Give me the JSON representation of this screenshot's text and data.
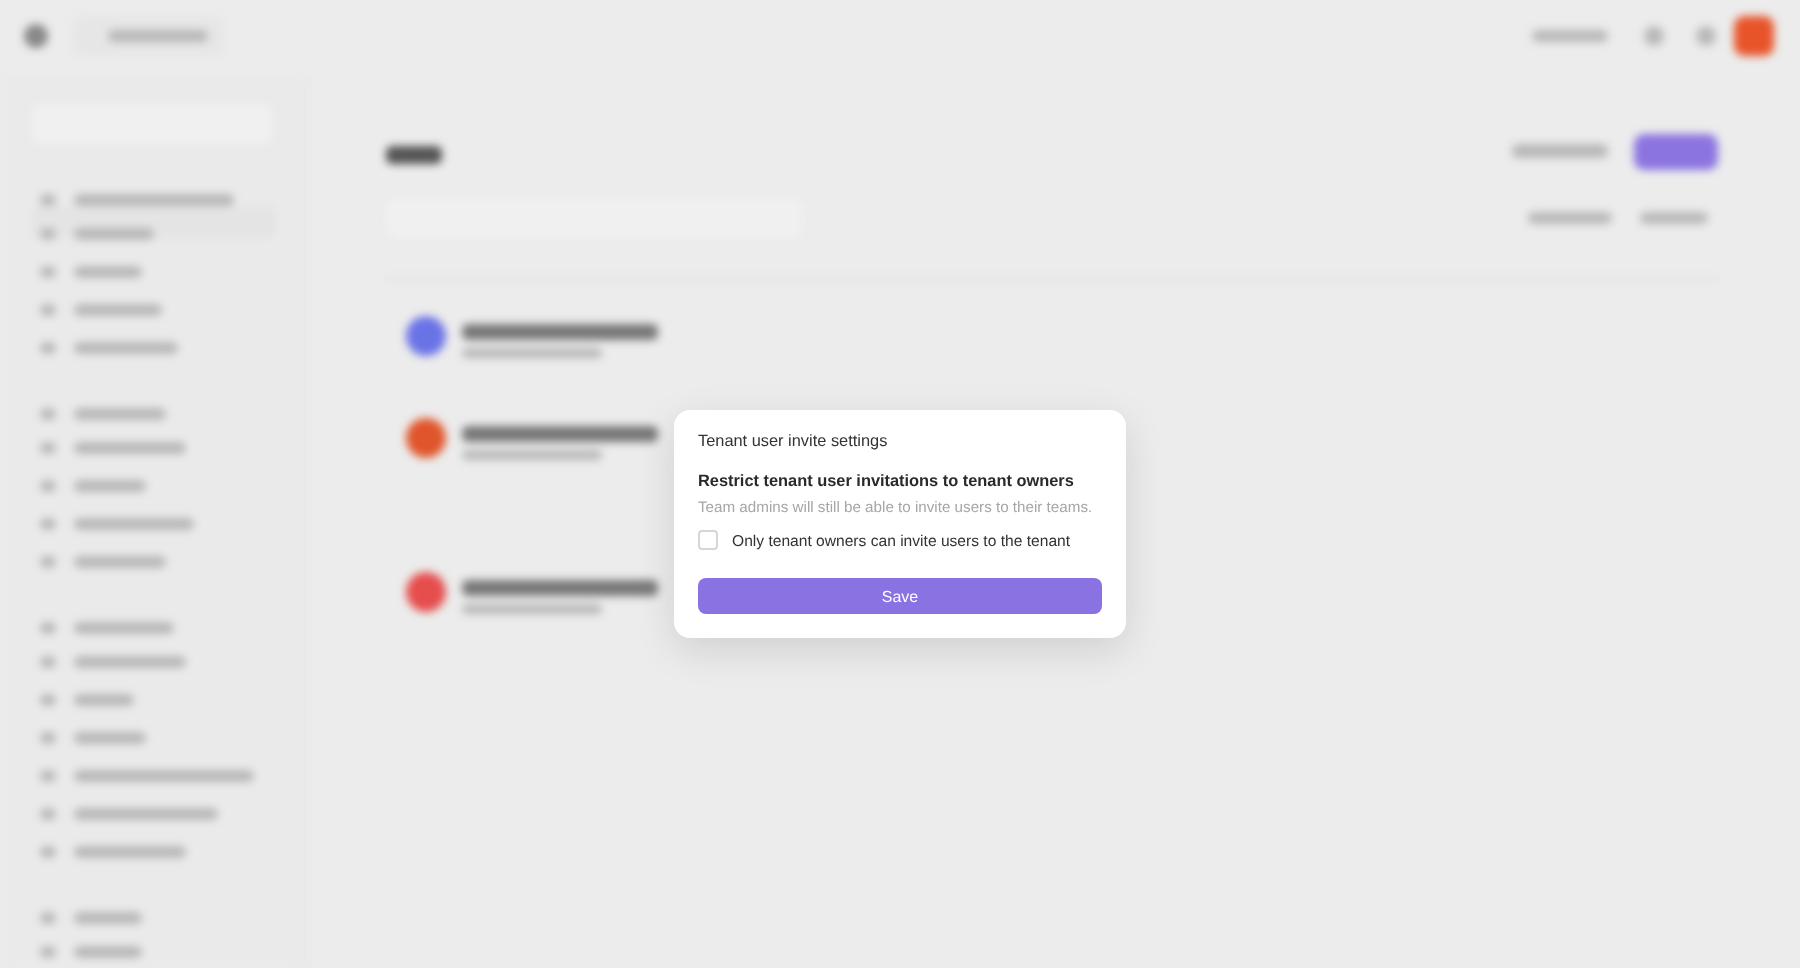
{
  "dialog": {
    "title": "Tenant user invite settings",
    "setting": {
      "heading": "Restrict tenant user invitations to tenant owners",
      "description": "Team admins will still be able to invite users to their teams.",
      "option": {
        "label": "Only tenant owners can invite users to the tenant",
        "checked": false
      }
    },
    "save_button": "Save"
  }
}
